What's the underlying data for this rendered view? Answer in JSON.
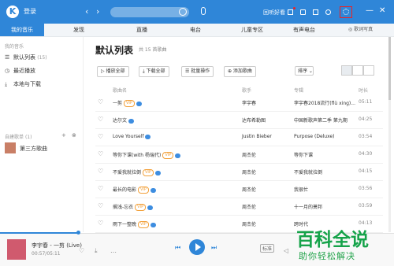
{
  "header": {
    "login_label": "登录",
    "back": "‹",
    "forward": "›",
    "vip_label": "回听好看",
    "min": "—",
    "close": "✕",
    "settings_icon": "gear-icon",
    "accent": "#2f86d8"
  },
  "tabs": [
    {
      "label": "我的音乐"
    },
    {
      "label": "发现"
    },
    {
      "label": "直播"
    },
    {
      "label": "电台"
    },
    {
      "label": "儿童专区"
    },
    {
      "label": "有声电台"
    }
  ],
  "tabs_right": {
    "label": "◎ 歌词写真"
  },
  "sidebar": {
    "section1": "我的音乐",
    "items": [
      {
        "label": "默认列表",
        "count": "(15)"
      },
      {
        "label": "最近播放"
      },
      {
        "label": "本地与下载"
      }
    ],
    "section2": "自建歌单",
    "count2": "(1)",
    "add": "+",
    "more": "⊗",
    "playlist": "第三方歌曲"
  },
  "main": {
    "title": "默认列表",
    "subtitle": "共 15 首歌曲",
    "buttons": {
      "play_all": "▷ 播放全部",
      "download_all": "⤓ 下载全部",
      "batch": "☰ 批量操作",
      "add_song": "⊕ 添加歌曲"
    },
    "sort": "排序 ⌄",
    "columns": {
      "name": "歌曲名",
      "singer": "歌手",
      "album": "专辑",
      "duration": "时长"
    },
    "rows": [
      {
        "name": "一剪",
        "tag": "VIP",
        "singer": "李宇春",
        "album": "李宇春2018流行(flü xing)...",
        "duration": "05:11"
      },
      {
        "name": "达尔文",
        "tag": "",
        "singer": "达布希勒图",
        "album": "中国新歌声第二季 第九期",
        "duration": "04:25"
      },
      {
        "name": "Love Yourself",
        "tag": "",
        "singer": "Justin Bieber",
        "album": "Purpose (Deluxe)",
        "duration": "03:54"
      },
      {
        "name": "等你下课(with 杨瑞代)",
        "tag": "VIP",
        "singer": "周杰伦",
        "album": "等你下课",
        "duration": "04:30"
      },
      {
        "name": "不爱我就拉倒",
        "tag": "VIP",
        "singer": "周杰伦",
        "album": "不爱我就拉倒",
        "duration": "04:15"
      },
      {
        "name": "最长的电影",
        "tag": "VIP",
        "singer": "周杰伦",
        "album": "我很忙",
        "duration": "03:56"
      },
      {
        "name": "搁浅-忘衣",
        "tag": "VIP",
        "singer": "周杰伦",
        "album": "十一月的萧邦",
        "duration": "03:59"
      },
      {
        "name": "雨下一整晚",
        "tag": "VIP",
        "singer": "周杰伦",
        "album": "跨时代",
        "duration": "04:13"
      },
      {
        "name": "退后",
        "tag": "VIP",
        "singer": "周杰伦",
        "album": "依然范特西",
        "duration": "04:02"
      }
    ]
  },
  "player": {
    "title": "李宇春 - 一剪 (Live)",
    "time": "00:57/05:11",
    "quality": "标准",
    "progress": 0.19
  },
  "watermark": {
    "main": "百科全说",
    "sub": "助你轻松解决"
  }
}
